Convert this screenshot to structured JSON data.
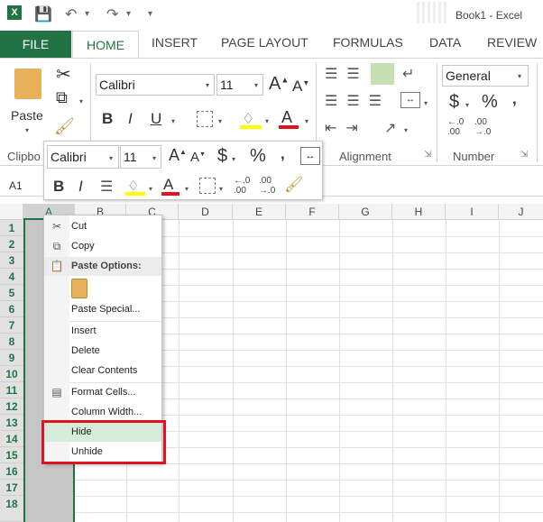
{
  "window": {
    "title": "Book1 - Excel"
  },
  "tabs": [
    "FILE",
    "HOME",
    "INSERT",
    "PAGE LAYOUT",
    "FORMULAS",
    "DATA",
    "REVIEW"
  ],
  "ribbon": {
    "paste_label": "Paste",
    "clipboard_group": "Clipbo",
    "font_name": "Calibri",
    "font_size": "11",
    "number_format": "General",
    "alignment_group": "Alignment",
    "number_group": "Number"
  },
  "mini_toolbar": {
    "font_name": "Calibri",
    "font_size": "11"
  },
  "name_box": "A1",
  "columns": [
    "A",
    "B",
    "C",
    "D",
    "E",
    "F",
    "G",
    "H",
    "I",
    "J"
  ],
  "rows": [
    "1",
    "2",
    "3",
    "4",
    "5",
    "6",
    "7",
    "8",
    "9",
    "10",
    "11",
    "12",
    "13",
    "14",
    "15",
    "16",
    "17",
    "18"
  ],
  "context_menu": {
    "cut": "Cut",
    "copy": "Copy",
    "paste_options": "Paste Options:",
    "paste_special": "Paste Special...",
    "insert": "Insert",
    "delete": "Delete",
    "clear_contents": "Clear Contents",
    "format_cells": "Format Cells...",
    "column_width": "Column Width...",
    "hide": "Hide",
    "unhide": "Unhide"
  },
  "colors": {
    "accent": "#217346",
    "highlight": "#e0141e",
    "menu_hover": "#d5ecdb"
  }
}
